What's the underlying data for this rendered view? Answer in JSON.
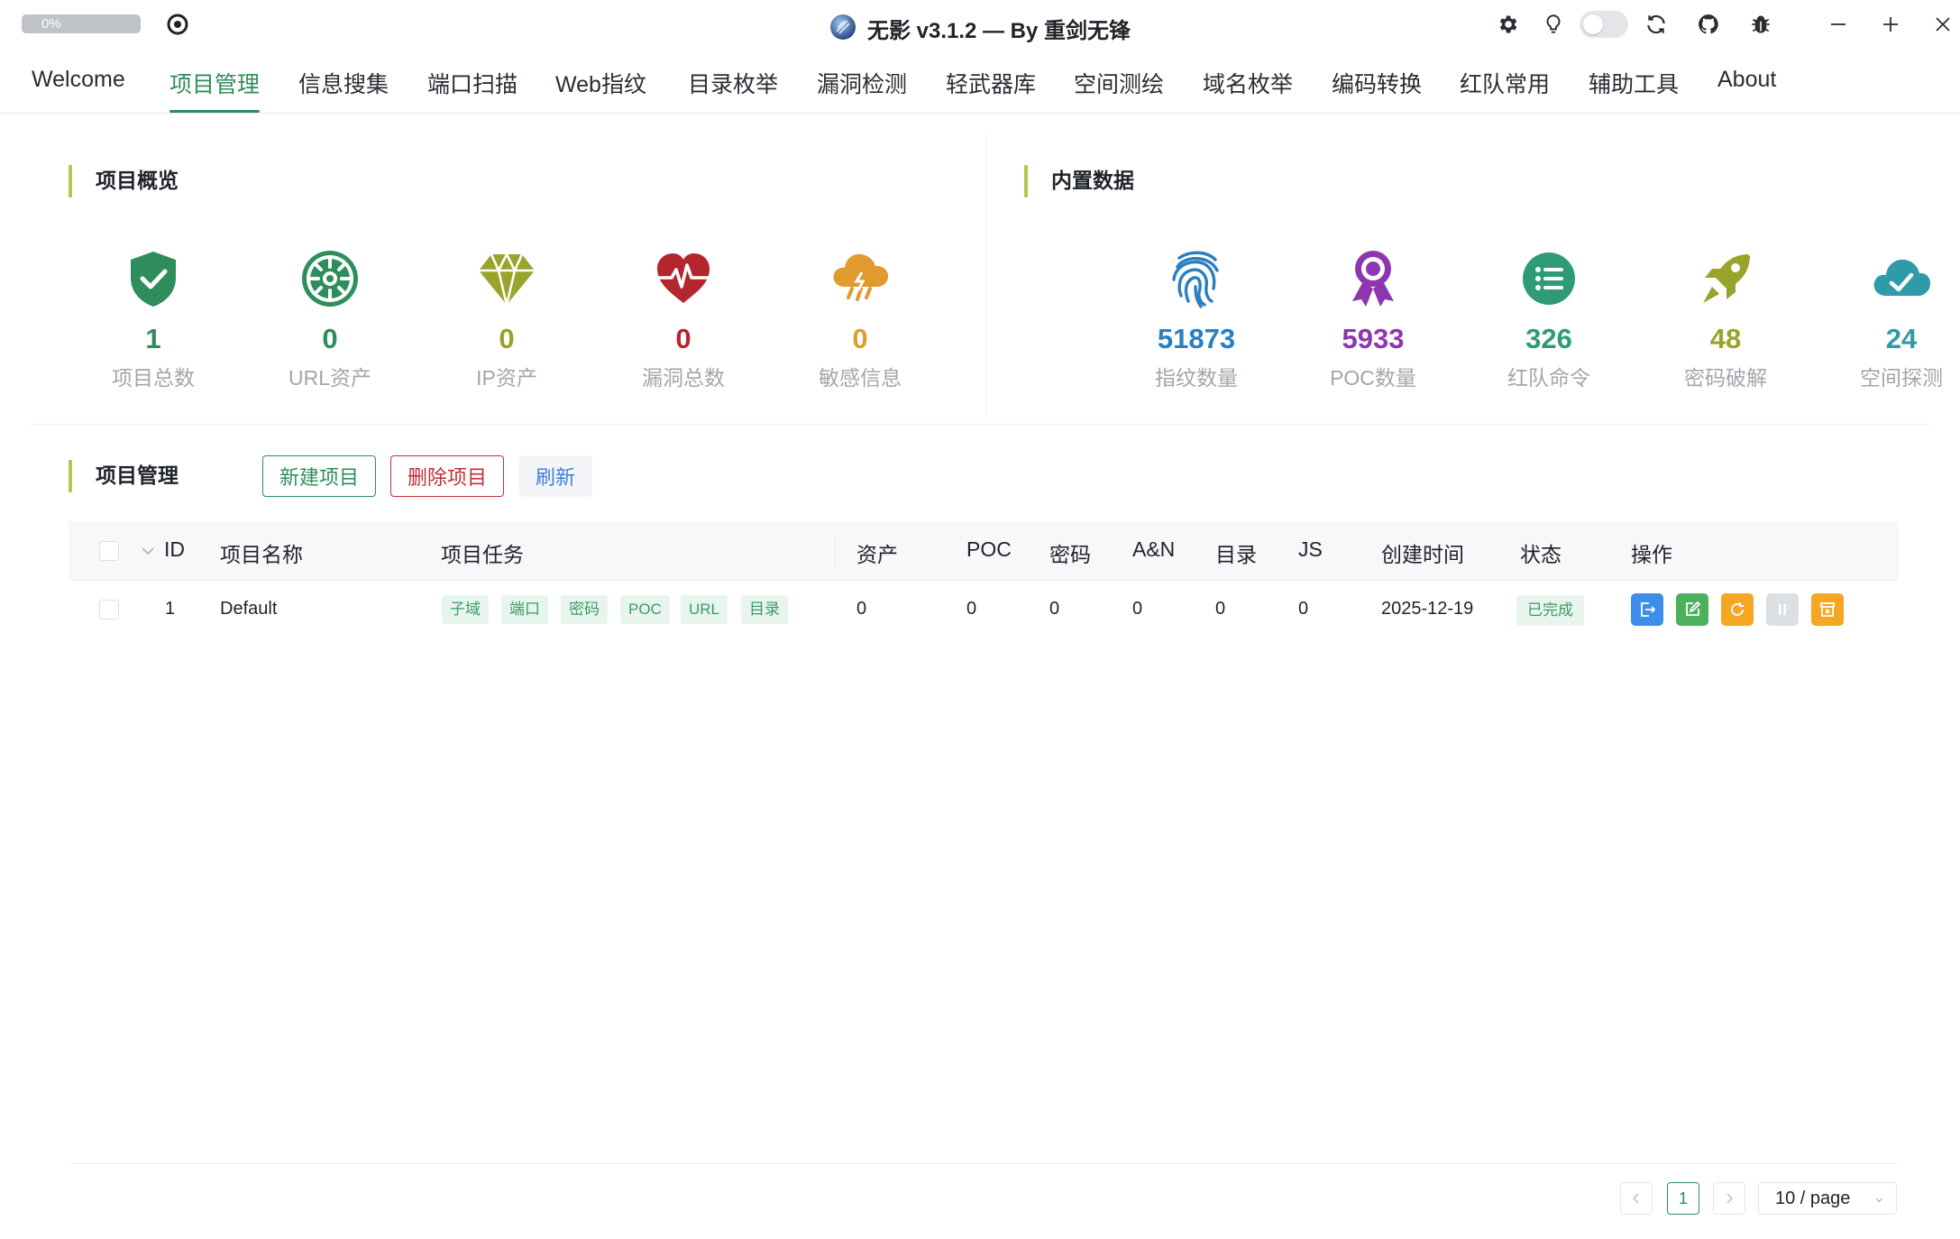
{
  "window": {
    "title": "无影 v3.1.2 — By 重剑无锋",
    "progress_text": "0%",
    "progress_value": 0
  },
  "tabs": [
    {
      "label": "Welcome",
      "active": false
    },
    {
      "label": "项目管理",
      "active": true
    },
    {
      "label": "信息搜集",
      "active": false
    },
    {
      "label": "端口扫描",
      "active": false
    },
    {
      "label": "Web指纹",
      "active": false
    },
    {
      "label": "目录枚举",
      "active": false
    },
    {
      "label": "漏洞检测",
      "active": false
    },
    {
      "label": "轻武器库",
      "active": false
    },
    {
      "label": "空间测绘",
      "active": false
    },
    {
      "label": "域名枚举",
      "active": false
    },
    {
      "label": "编码转换",
      "active": false
    },
    {
      "label": "红队常用",
      "active": false
    },
    {
      "label": "辅助工具",
      "active": false
    },
    {
      "label": "About",
      "active": false
    }
  ],
  "overview": {
    "title": "项目概览",
    "stats": [
      {
        "value": "1",
        "label": "项目总数",
        "icon": "shield-check-icon",
        "color": "#2f8d5b"
      },
      {
        "value": "0",
        "label": "URL资产",
        "icon": "virus-icon",
        "color": "#2f8d5b"
      },
      {
        "value": "0",
        "label": "IP资产",
        "icon": "diamond-icon",
        "color": "#9aa32a"
      },
      {
        "value": "0",
        "label": "漏洞总数",
        "icon": "heart-pulse-icon",
        "color": "#b3262e"
      },
      {
        "value": "0",
        "label": "敏感信息",
        "icon": "storm-cloud-icon",
        "color": "#e09a2e"
      }
    ]
  },
  "builtin": {
    "title": "内置数据",
    "stats": [
      {
        "value": "51873",
        "label": "指纹数量",
        "icon": "fingerprint-icon",
        "color": "#2a7fc0"
      },
      {
        "value": "5933",
        "label": "POC数量",
        "icon": "award-ribbon-icon",
        "color": "#8e36b0"
      },
      {
        "value": "326",
        "label": "红队命令",
        "icon": "list-circle-icon",
        "color": "#2f9a76"
      },
      {
        "value": "48",
        "label": "密码破解",
        "icon": "rocket-icon",
        "color": "#9aa32a"
      },
      {
        "value": "24",
        "label": "空间探测",
        "icon": "cloud-check-icon",
        "color": "#2f9aa8"
      }
    ]
  },
  "project_mgmt": {
    "title": "项目管理",
    "new_button": "新建项目",
    "delete_button": "删除项目",
    "refresh_button": "刷新"
  },
  "table": {
    "columns": [
      "ID",
      "项目名称",
      "项目任务",
      "资产",
      "POC",
      "密码",
      "A&N",
      "目录",
      "JS",
      "创建时间",
      "状态",
      "操作"
    ],
    "rows": [
      {
        "id": "1",
        "name": "Default",
        "tasks": [
          "子域",
          "端口",
          "密码",
          "POC",
          "URL",
          "目录"
        ],
        "assets": "0",
        "poc": "0",
        "password": "0",
        "an": "0",
        "dir": "0",
        "js": "0",
        "created": "2025-12-19",
        "status": "已完成"
      }
    ]
  },
  "pagination": {
    "current_page": "1",
    "page_size": "10 / page"
  },
  "colors": {
    "accent": "#2f8d5b",
    "danger": "#c0303a",
    "link": "#3c7fd9",
    "op_blue": "#3d8ee8",
    "op_green": "#4cb05c",
    "op_orange": "#f5a623",
    "op_gray": "#dcdfe3"
  }
}
